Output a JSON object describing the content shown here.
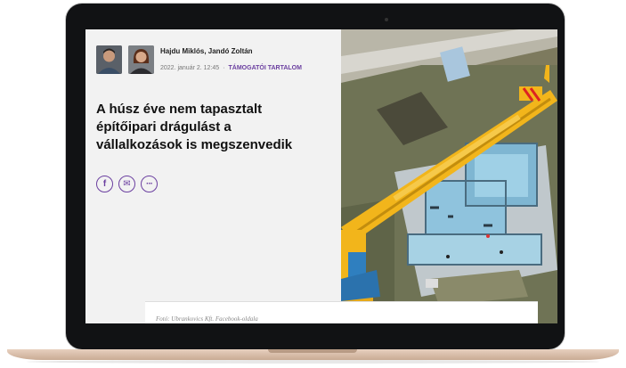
{
  "article": {
    "authors": "Hajdu Miklós, Jandó Zoltán",
    "date": "2022. január 2. 12:45",
    "separator": "·",
    "tag": "Támogatói tartalom",
    "headline": "A húsz éve nem tapasztalt építőipari drágulást a vállalkozások is megszenvedik",
    "photo_caption": "Fotó: Ubrankovics Kft. Facebook-oldala"
  },
  "share": {
    "facebook_icon": "f",
    "mail_icon": "✉",
    "more_icon": "···"
  },
  "colors": {
    "accent": "#6b3fa0",
    "panel_bg": "#f2f2f2",
    "crane_yellow": "#f2b51b"
  }
}
